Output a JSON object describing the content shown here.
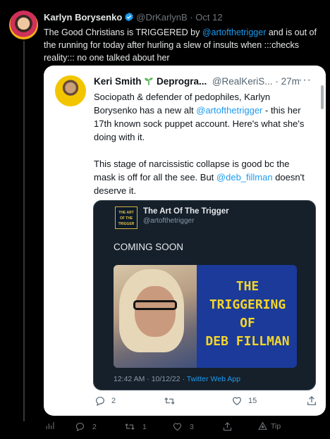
{
  "outer": {
    "name": "Karlyn Borysenko",
    "handle": "@DrKarlynB",
    "sep": "·",
    "date": "Oct 12",
    "text_before": "The Good Christians is TRIGGERED by ",
    "mention": "@artofthetrigger",
    "text_after": " and is out of the running for today after hurling a slew of insults when :::checks reality::: no one talked about her"
  },
  "quoted": {
    "name_prefix": "Keri Smith",
    "name_suffix": "Deprogra...",
    "handle": "@RealKeriS...",
    "sep": "·",
    "time": "27m",
    "more": "···",
    "p1_a": "Sociopath & defender of pedophiles, Karlyn Borysenko has a new alt ",
    "p1_mention": "@artofthetrigger",
    "p1_b": " - this her 17th known sock puppet account. Here's what she's doing with it.",
    "p2_a": "This stage of narcissistic collapse is good bc the mask is off for all the see. But ",
    "p2_mention": "@deb_fillman",
    "p2_b": " doesn't deserve it.",
    "actions": {
      "replies": "2",
      "retweets": "",
      "likes": "15"
    }
  },
  "embed": {
    "logo_lines": [
      "THE ART",
      "OF THE",
      "TRIGGER"
    ],
    "name": "The Art Of The Trigger",
    "handle": "@artofthetrigger",
    "coming": "COMING SOON",
    "title_lines": [
      "THE",
      "TRIGGERING",
      "OF",
      "DEB FILLMAN"
    ],
    "timestamp": "12:42 AM · 10/12/22 · ",
    "source": "Twitter Web App"
  },
  "bottom_actions": {
    "replies": "2",
    "retweets": "1",
    "likes": "3",
    "tip": "Tip"
  },
  "colors": {
    "accent": "#1d9bf0",
    "background": "#000000",
    "title_yellow": "#f3d52a"
  }
}
